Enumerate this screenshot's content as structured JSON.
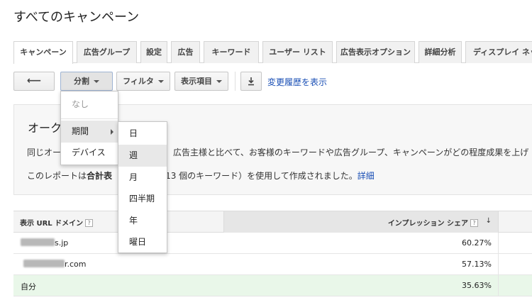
{
  "page": {
    "title": "すべてのキャンペーン"
  },
  "tabs": [
    {
      "label": "キャンペーン",
      "active": true
    },
    {
      "label": "広告グループ"
    },
    {
      "label": "設定"
    },
    {
      "label": "広告"
    },
    {
      "label": "キーワード"
    },
    {
      "label": "ユーザー リスト"
    },
    {
      "label": "広告表示オプション"
    },
    {
      "label": "詳細分析"
    },
    {
      "label": "ディスプレイ ネッ"
    }
  ],
  "toolbar": {
    "back_icon": "back-arrow-icon",
    "segment_label": "分割",
    "filter_label": "フィルタ",
    "columns_label": "表示項目",
    "download_icon": "download-icon",
    "history_link": "変更履歴を表示"
  },
  "panel": {
    "heading": "オーク",
    "line1_a": "同じオー",
    "line1_b": "広告主様と比べて、お客様のキーワードや広告グループ、キャンペーンがどの程度成果を上げ",
    "line2_a": "このレポートは",
    "line2_bold": "合計表",
    "line2_c": "%（213 個のキーワード）を使用して作成されました。",
    "line2_link": "詳細"
  },
  "table": {
    "col_domain": "表示 URL ドメイン",
    "col_share": "インプレッション シェア",
    "help_icon": "?",
    "sort_icon": "↓",
    "rows": [
      {
        "domain_visible": "s.jp",
        "share": "60.27%"
      },
      {
        "domain_visible": "r.com",
        "share": "57.13%"
      },
      {
        "domain_visible": "自分",
        "share": "35.63%"
      }
    ]
  },
  "segment_menu": {
    "items": [
      "なし",
      "期間",
      "デバイス"
    ]
  },
  "period_submenu": {
    "items": [
      "日",
      "週",
      "月",
      "四半期",
      "年",
      "曜日"
    ]
  }
}
